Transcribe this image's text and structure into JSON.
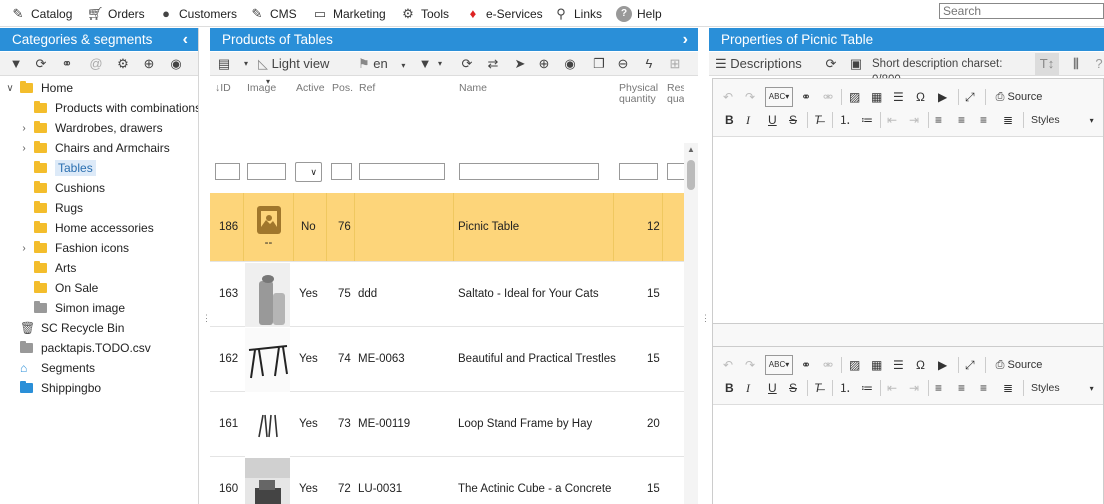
{
  "menu": {
    "items": [
      {
        "label": "Catalog",
        "icon": "edit-icon"
      },
      {
        "label": "Orders",
        "icon": "cart-icon"
      },
      {
        "label": "Customers",
        "icon": "user-icon"
      },
      {
        "label": "CMS",
        "icon": "edit-icon"
      },
      {
        "label": "Marketing",
        "icon": "ticket-icon"
      },
      {
        "label": "Tools",
        "icon": "gear-icon"
      },
      {
        "label": "e-Services",
        "icon": "gem-icon"
      },
      {
        "label": "Links",
        "icon": "link-icon"
      },
      {
        "label": "Help",
        "icon": "help-icon"
      }
    ],
    "search_placeholder": "Search"
  },
  "categories": {
    "title": "Categories & segments",
    "tree": [
      {
        "label": "Home"
      },
      {
        "label": "Products with combinations"
      },
      {
        "label": "Wardrobes, drawers"
      },
      {
        "label": "Chairs and Armchairs"
      },
      {
        "label": "Tables"
      },
      {
        "label": "Cushions"
      },
      {
        "label": "Rugs"
      },
      {
        "label": "Home accessories"
      },
      {
        "label": "Fashion icons"
      },
      {
        "label": "Arts"
      },
      {
        "label": "On Sale"
      },
      {
        "label": "Simon image"
      },
      {
        "label": "SC Recycle Bin"
      },
      {
        "label": "packtapis.TODO.csv"
      },
      {
        "label": "Segments"
      },
      {
        "label": "Shippingbo"
      }
    ]
  },
  "products": {
    "title": "Products of Tables",
    "view": "Light view",
    "lang": "en",
    "columns": {
      "id": "ID",
      "image": "Image",
      "active": "Active",
      "pos": "Pos.",
      "ref": "Ref",
      "name": "Name",
      "phys1": "Physical",
      "phys2": "quantity",
      "res1": "Reserv",
      "res2": "quantit"
    },
    "rows": [
      {
        "id": "186",
        "img_text": "--",
        "active": "No",
        "pos": "76",
        "ref": "",
        "name": "Picnic Table",
        "qty": "12"
      },
      {
        "id": "163",
        "img_text": "",
        "active": "Yes",
        "pos": "75",
        "ref": "ddd",
        "name": "Saltato - Ideal for Your Cats",
        "qty": "15"
      },
      {
        "id": "162",
        "img_text": "",
        "active": "Yes",
        "pos": "74",
        "ref": "ME-0063",
        "name": "Beautiful and Practical Trestles",
        "qty": "15"
      },
      {
        "id": "161",
        "img_text": "",
        "active": "Yes",
        "pos": "73",
        "ref": "ME-00119",
        "name": "Loop Stand Frame by Hay",
        "qty": "20"
      },
      {
        "id": "160",
        "img_text": "",
        "active": "Yes",
        "pos": "72",
        "ref": "LU-0031",
        "name": "The Actinic Cube - a Concrete E",
        "qty": "15"
      }
    ]
  },
  "properties": {
    "title": "Properties of Picnic Table",
    "tab": "Descriptions",
    "charset": "Short description charset: 0/800",
    "editor": {
      "source": "Source",
      "styles": "Styles",
      "spell": "ABC"
    }
  },
  "colors": {
    "header": "#2a8fd8",
    "selected_row": "#fdd57a",
    "folder": "#f3bd2c"
  }
}
